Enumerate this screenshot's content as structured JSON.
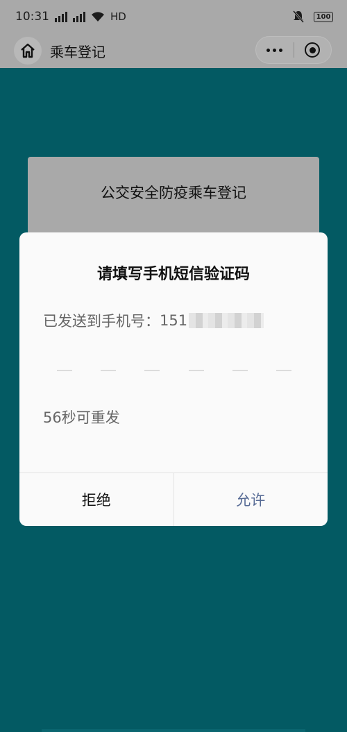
{
  "status_bar": {
    "time": "10:31",
    "network_1": "4G",
    "network_2": "4G",
    "hd_label": "HD",
    "battery": "100"
  },
  "nav": {
    "title": "乘车登记"
  },
  "background_card": {
    "title": "公交安全防疫乘车登记"
  },
  "modal": {
    "title": "请填写手机短信验证码",
    "sent_label": "已发送到手机号：",
    "phone_prefix": "151",
    "code_slots": 6,
    "resend_text": "56秒可重发",
    "reject_label": "拒绝",
    "allow_label": "允许"
  },
  "colors": {
    "page_background": "#035a63",
    "overlay_gray": "#a9a9a9",
    "allow_text": "#576b95"
  }
}
